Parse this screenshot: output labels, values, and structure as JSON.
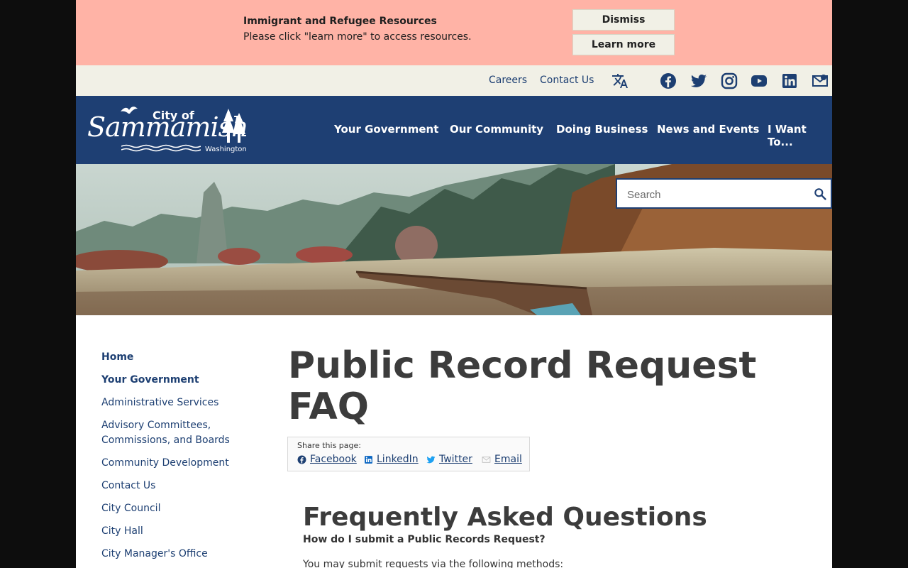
{
  "alert": {
    "title": "Immigrant and Refugee Resources",
    "text": "Please click \"learn more\" to access resources.",
    "dismiss_label": "Dismiss",
    "learn_more_label": "Learn more"
  },
  "utility": {
    "links": [
      "Careers",
      "Contact Us"
    ],
    "icons": [
      "translate-icon",
      "facebook-icon",
      "twitter-icon",
      "instagram-icon",
      "youtube-icon",
      "linkedin-icon",
      "newsletter-icon"
    ]
  },
  "logo": {
    "city_of": "City of",
    "name": "Sammamish",
    "state": "Washington"
  },
  "nav": {
    "items": [
      "Your Government",
      "Our Community",
      "Doing Business",
      "News and Events",
      "I Want To..."
    ]
  },
  "search": {
    "placeholder": "Search"
  },
  "sidebar": {
    "items": [
      {
        "label": "Home"
      },
      {
        "label": "Your Government"
      },
      {
        "label": "Administrative Services"
      },
      {
        "label": "Advisory Committees,"
      },
      {
        "label": "Commissions, and Boards"
      },
      {
        "label": "Community Development"
      },
      {
        "label": "Contact Us"
      },
      {
        "label": "City Council"
      },
      {
        "label": "City Hall"
      },
      {
        "label": "City Manager's Office"
      }
    ]
  },
  "main": {
    "title_line1": "Public Record Request",
    "title_line2": "FAQ",
    "share_label": "Share this page:",
    "share": [
      "Facebook",
      "LinkedIn",
      "Twitter",
      "Email"
    ],
    "faq_heading": "Frequently Asked Questions",
    "question": "How do I submit a Public Records Request?",
    "answer": "You may submit requests via the following methods:"
  },
  "colors": {
    "alert_bg": "#ffb3a6",
    "utility_bg": "#f1f0e6",
    "brand_navy": "#1e3f73",
    "link": "#1d3f72"
  }
}
